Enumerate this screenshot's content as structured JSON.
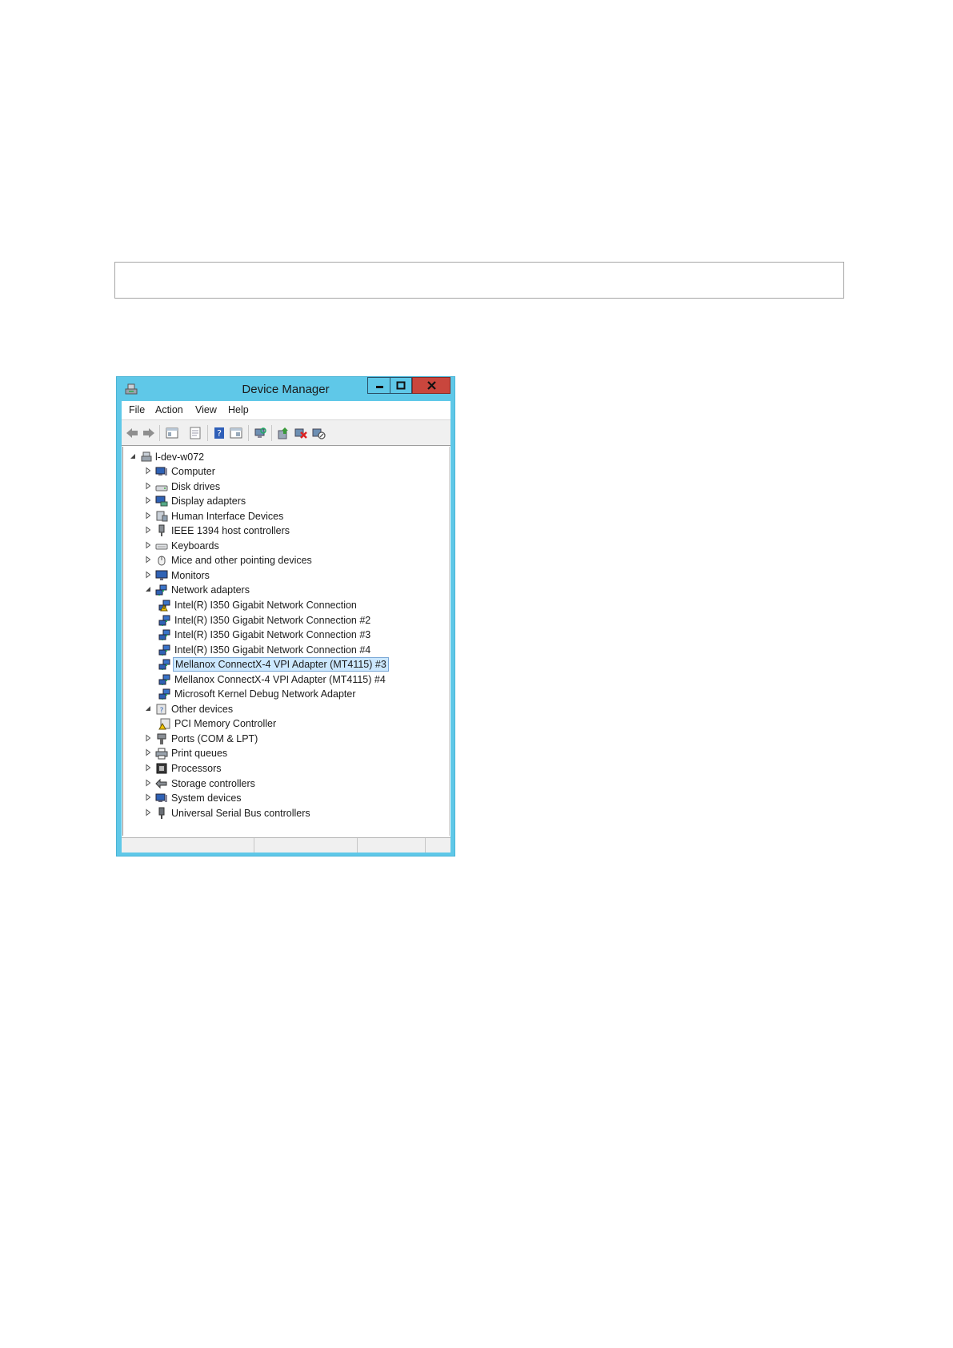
{
  "window": {
    "title": "Device Manager"
  },
  "menu": [
    "File",
    "Action",
    "View",
    "Help"
  ],
  "toolbar": {
    "icons": [
      "back-icon",
      "forward-icon",
      "show-hide-console-tree-icon",
      "properties-icon",
      "help-icon",
      "view-icon",
      "scan-hardware-icon",
      "update-driver-icon",
      "uninstall-icon",
      "disable-icon"
    ]
  },
  "tree": {
    "root": "l-dev-w072",
    "items": [
      {
        "label": "Computer",
        "icon": "computer-icon",
        "expander": "collapsed"
      },
      {
        "label": "Disk drives",
        "icon": "disk-drive-icon",
        "expander": "collapsed"
      },
      {
        "label": "Display adapters",
        "icon": "display-adapter-icon",
        "expander": "collapsed"
      },
      {
        "label": "Human Interface Devices",
        "icon": "hid-icon",
        "expander": "collapsed"
      },
      {
        "label": "IEEE 1394 host controllers",
        "icon": "ieee1394-icon",
        "expander": "collapsed"
      },
      {
        "label": "Keyboards",
        "icon": "keyboard-icon",
        "expander": "collapsed"
      },
      {
        "label": "Mice and other pointing devices",
        "icon": "mouse-icon",
        "expander": "collapsed"
      },
      {
        "label": "Monitors",
        "icon": "monitor-icon",
        "expander": "collapsed"
      },
      {
        "label": "Network adapters",
        "icon": "network-adapter-icon",
        "expander": "expanded"
      },
      {
        "label": "Intel(R) I350 Gigabit Network Connection",
        "icon": "network-adapter-warning-icon",
        "child": true
      },
      {
        "label": "Intel(R) I350 Gigabit Network Connection #2",
        "icon": "network-adapter-icon",
        "child": true
      },
      {
        "label": "Intel(R) I350 Gigabit Network Connection #3",
        "icon": "network-adapter-icon",
        "child": true
      },
      {
        "label": "Intel(R) I350 Gigabit Network Connection #4",
        "icon": "network-adapter-icon",
        "child": true
      },
      {
        "label": "Mellanox ConnectX-4 VPI Adapter (MT4115) #3",
        "icon": "network-adapter-icon",
        "child": true,
        "selected": true
      },
      {
        "label": "Mellanox ConnectX-4 VPI Adapter (MT4115) #4",
        "icon": "network-adapter-icon",
        "child": true
      },
      {
        "label": "Microsoft Kernel Debug Network Adapter",
        "icon": "network-adapter-icon",
        "child": true
      },
      {
        "label": "Other devices",
        "icon": "other-devices-icon",
        "expander": "expanded"
      },
      {
        "label": "PCI Memory Controller",
        "icon": "unknown-device-warning-icon",
        "child": true
      },
      {
        "label": "Ports (COM & LPT)",
        "icon": "port-icon",
        "expander": "collapsed"
      },
      {
        "label": "Print queues",
        "icon": "printer-icon",
        "expander": "collapsed"
      },
      {
        "label": "Processors",
        "icon": "processor-icon",
        "expander": "collapsed"
      },
      {
        "label": "Storage controllers",
        "icon": "storage-controller-icon",
        "expander": "collapsed"
      },
      {
        "label": "System devices",
        "icon": "system-devices-icon",
        "expander": "collapsed"
      },
      {
        "label": "Universal Serial Bus controllers",
        "icon": "usb-icon",
        "expander": "collapsed"
      }
    ]
  },
  "colors": {
    "frame": "#5fc8e8",
    "close": "#c9463d",
    "selection": "#cce8ff"
  }
}
